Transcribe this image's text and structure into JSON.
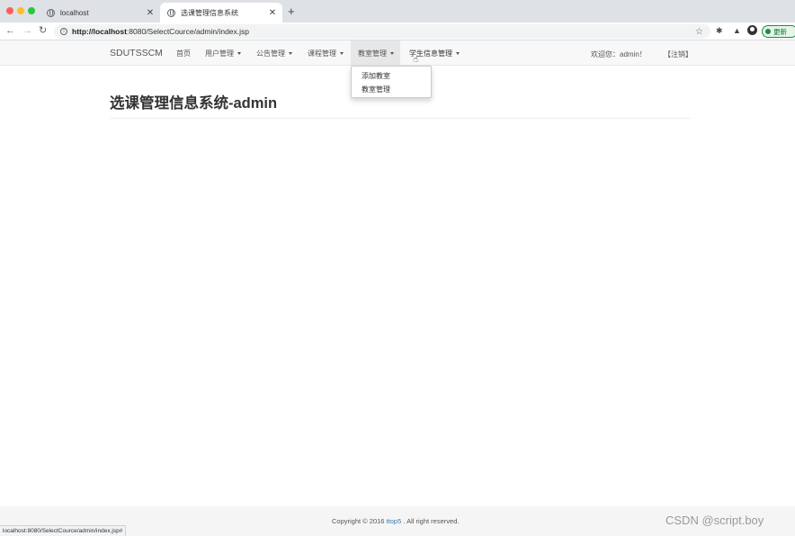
{
  "browser": {
    "tabs": [
      {
        "title": "localhost",
        "close": "✕"
      },
      {
        "title": "选课管理信息系统",
        "close": "✕"
      }
    ],
    "new_tab": "+",
    "nav": {
      "back": "←",
      "forward": "→",
      "reload": "↻"
    },
    "address": {
      "host": "http://localhost",
      "rest": ":8080/SelectCource/admin/index.jsp",
      "info_icon": "i",
      "star": "☆"
    },
    "toolbar_icons": {
      "extensions": "✱",
      "labs": "▲"
    },
    "update_label": "更新",
    "status_url": "localhost:8080/SelectCource/admin/index.jsp#"
  },
  "navbar": {
    "brand": "SDUTSSCM",
    "items": [
      {
        "label": "首页"
      },
      {
        "label": "用户管理"
      },
      {
        "label": "公告管理"
      },
      {
        "label": "课程管理"
      },
      {
        "label": "教室管理"
      },
      {
        "label": "学生信息管理"
      }
    ],
    "welcome": "欢迎您：admin！",
    "logout": "【注销】"
  },
  "dropdown": {
    "items": [
      {
        "label": "添加教室"
      },
      {
        "label": "教室管理"
      }
    ]
  },
  "main": {
    "title": "选课管理信息系统-admin"
  },
  "footer": {
    "prefix": "Copyright © 2016 ",
    "link": "ttop5",
    "suffix": " . All right reserved."
  },
  "watermark": "CSDN @script.boy"
}
